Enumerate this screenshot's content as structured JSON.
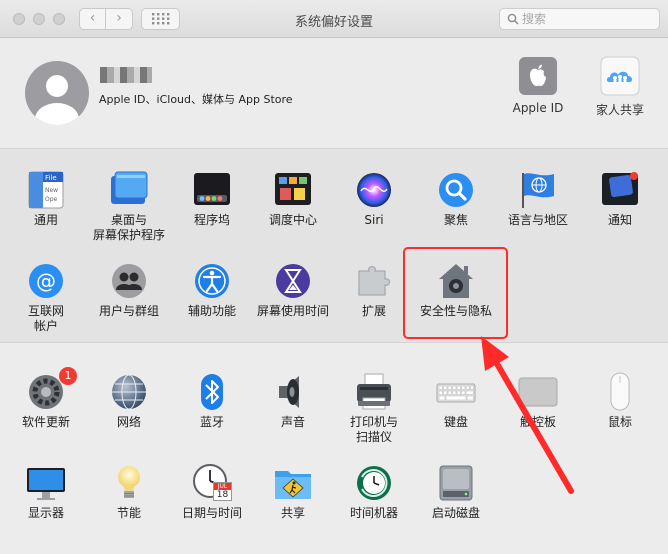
{
  "window": {
    "title": "系统偏好设置"
  },
  "search": {
    "placeholder": "搜索"
  },
  "account": {
    "description": "Apple ID、iCloud、媒体与 App Store"
  },
  "top_items": [
    {
      "label": "Apple ID",
      "icon": "apple-logo-icon"
    },
    {
      "label": "家人共享",
      "icon": "family-sharing-icon"
    }
  ],
  "row1": [
    {
      "label": "通用",
      "icon": "general-icon"
    },
    {
      "label": "桌面与\n屏幕保护程序",
      "icon": "desktop-screensaver-icon"
    },
    {
      "label": "程序坞",
      "icon": "dock-icon"
    },
    {
      "label": "调度中心",
      "icon": "mission-control-icon"
    },
    {
      "label": "Siri",
      "icon": "siri-icon"
    },
    {
      "label": "聚焦",
      "icon": "spotlight-icon"
    },
    {
      "label": "语言与地区",
      "icon": "language-region-icon"
    },
    {
      "label": "通知",
      "icon": "notifications-icon"
    }
  ],
  "row2": [
    {
      "label": "互联网\n帐户",
      "icon": "internet-accounts-icon"
    },
    {
      "label": "用户与群组",
      "icon": "users-groups-icon"
    },
    {
      "label": "辅助功能",
      "icon": "accessibility-icon"
    },
    {
      "label": "屏幕使用时间",
      "icon": "screen-time-icon"
    },
    {
      "label": "扩展",
      "icon": "extensions-icon"
    },
    {
      "label": "安全性与隐私",
      "icon": "security-privacy-icon"
    }
  ],
  "row3": [
    {
      "label": "软件更新",
      "icon": "software-update-icon",
      "badge": "1"
    },
    {
      "label": "网络",
      "icon": "network-icon"
    },
    {
      "label": "蓝牙",
      "icon": "bluetooth-icon"
    },
    {
      "label": "声音",
      "icon": "sound-icon"
    },
    {
      "label": "打印机与\n扫描仪",
      "icon": "printers-scanners-icon"
    },
    {
      "label": "键盘",
      "icon": "keyboard-icon"
    },
    {
      "label": "触控板",
      "icon": "trackpad-icon"
    },
    {
      "label": "鼠标",
      "icon": "mouse-icon"
    }
  ],
  "row4": [
    {
      "label": "显示器",
      "icon": "displays-icon"
    },
    {
      "label": "节能",
      "icon": "energy-saver-icon"
    },
    {
      "label": "日期与时间",
      "icon": "date-time-icon",
      "calendar_month": "JUL",
      "calendar_day": "18"
    },
    {
      "label": "共享",
      "icon": "sharing-icon"
    },
    {
      "label": "时间机器",
      "icon": "time-machine-icon"
    },
    {
      "label": "启动磁盘",
      "icon": "startup-disk-icon"
    }
  ],
  "colors": {
    "highlight": "#ff2b2b",
    "accent": "#1a8cff"
  }
}
